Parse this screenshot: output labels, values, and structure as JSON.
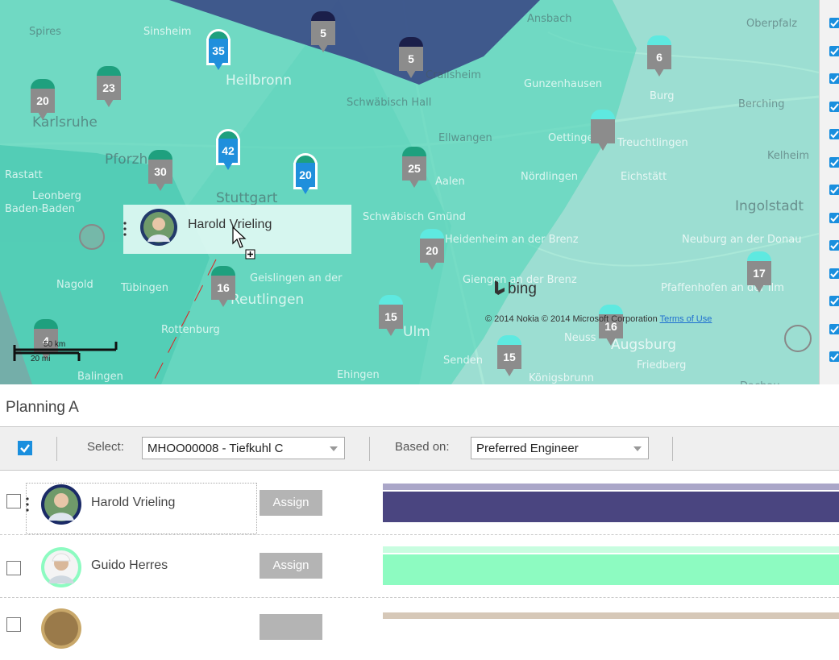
{
  "map": {
    "places": [
      {
        "text": "Spires",
        "cls": ""
      },
      {
        "text": "Sinsheim",
        "cls": "w"
      },
      {
        "text": "Ansbach",
        "cls": ""
      },
      {
        "text": "Oberpfalz",
        "cls": ""
      },
      {
        "text": "Heilbronn",
        "cls": "big w"
      },
      {
        "text": "Crailsheim",
        "cls": ""
      },
      {
        "text": "Gunzenhausen",
        "cls": "w"
      },
      {
        "text": "Burg",
        "cls": "w"
      },
      {
        "text": "Berching",
        "cls": ""
      },
      {
        "text": "Schwäbisch Hall",
        "cls": ""
      },
      {
        "text": "Karlsruhe",
        "cls": "big"
      },
      {
        "text": "Ellwangen",
        "cls": ""
      },
      {
        "text": "Oettingen",
        "cls": "w"
      },
      {
        "text": "Treuchtlingen",
        "cls": "w"
      },
      {
        "text": "Kelheim",
        "cls": ""
      },
      {
        "text": "Pforzheim",
        "cls": "big"
      },
      {
        "text": "Nördlingen",
        "cls": "w"
      },
      {
        "text": "Eichstätt",
        "cls": "w"
      },
      {
        "text": "Rastatt",
        "cls": "w"
      },
      {
        "text": "Leonberg",
        "cls": "w"
      },
      {
        "text": "Stuttgart",
        "cls": "big"
      },
      {
        "text": "Aalen",
        "cls": "w"
      },
      {
        "text": "Ingolstadt",
        "cls": "big"
      },
      {
        "text": "Baden-Baden",
        "cls": "w"
      },
      {
        "text": "Schwäbisch Gmünd",
        "cls": "w"
      },
      {
        "text": "Heidenheim an der Brenz",
        "cls": "w"
      },
      {
        "text": "Neuburg an der Donau",
        "cls": "w"
      },
      {
        "text": "Nagold",
        "cls": "w"
      },
      {
        "text": "Tübingen",
        "cls": "w"
      },
      {
        "text": "Geislingen an der",
        "cls": "w"
      },
      {
        "text": "Giengen an der Brenz",
        "cls": "w"
      },
      {
        "text": "Pfaffenhofen an der Ilm",
        "cls": "w"
      },
      {
        "text": "Reutlingen",
        "cls": "big w"
      },
      {
        "text": "Rottenburg",
        "cls": "w"
      },
      {
        "text": "Ulm",
        "cls": "big w"
      },
      {
        "text": "Neuss",
        "cls": "w"
      },
      {
        "text": "Augsburg",
        "cls": "big w"
      },
      {
        "text": "Friedberg",
        "cls": "w"
      },
      {
        "text": "Senden",
        "cls": "w"
      },
      {
        "text": "Balingen",
        "cls": "w"
      },
      {
        "text": "Ehingen",
        "cls": "w"
      },
      {
        "text": "Königsbrunn",
        "cls": "w"
      },
      {
        "text": "Dachau",
        "cls": ""
      }
    ],
    "pins": [
      {
        "count": "35",
        "style": "blue green"
      },
      {
        "count": "5",
        "style": "dark"
      },
      {
        "count": "5",
        "style": "dark"
      },
      {
        "count": "6",
        "style": "cyan"
      },
      {
        "count": "23",
        "style": "green"
      },
      {
        "count": "20",
        "style": "green"
      },
      {
        "count": "42",
        "style": "blue green"
      },
      {
        "count": "",
        "style": "cyan"
      },
      {
        "count": "30",
        "style": "green"
      },
      {
        "count": "20",
        "style": "blue green"
      },
      {
        "count": "25",
        "style": "green"
      },
      {
        "count": "20",
        "style": "cyan"
      },
      {
        "count": "17",
        "style": "cyan"
      },
      {
        "count": "16",
        "style": "green"
      },
      {
        "count": "15",
        "style": "cyan"
      },
      {
        "count": "16",
        "style": "cyan"
      },
      {
        "count": "15",
        "style": "cyan"
      },
      {
        "count": "4",
        "style": "green"
      }
    ],
    "drag_card_name": "Harold Vrieling",
    "bing_label": "bing",
    "copyright": "© 2014 Nokia © 2014 Microsoft Corporation",
    "terms_link": "Terms of Use",
    "scale_km": "50 km",
    "scale_mi": "20 mi",
    "colors": {
      "territory": "#5ed8c0",
      "dark_territory": "#3a4a86",
      "blue_pin": "#1f8fdc",
      "bar_purple": "#4a4580",
      "bar_green": "#8dfbc1"
    }
  },
  "planning": {
    "title": "Planning A",
    "select_label": "Select:",
    "select_value": "MHOO00008 - Tiefkuhl C",
    "based_on_label": "Based on:",
    "based_on_value": "Preferred Engineer",
    "rows": [
      {
        "name": "Harold Vrieling",
        "assign": "Assign",
        "checked": false
      },
      {
        "name": "Guido Herres",
        "assign": "Assign",
        "checked": false
      },
      {
        "name": "",
        "assign": "",
        "checked": false
      }
    ]
  }
}
